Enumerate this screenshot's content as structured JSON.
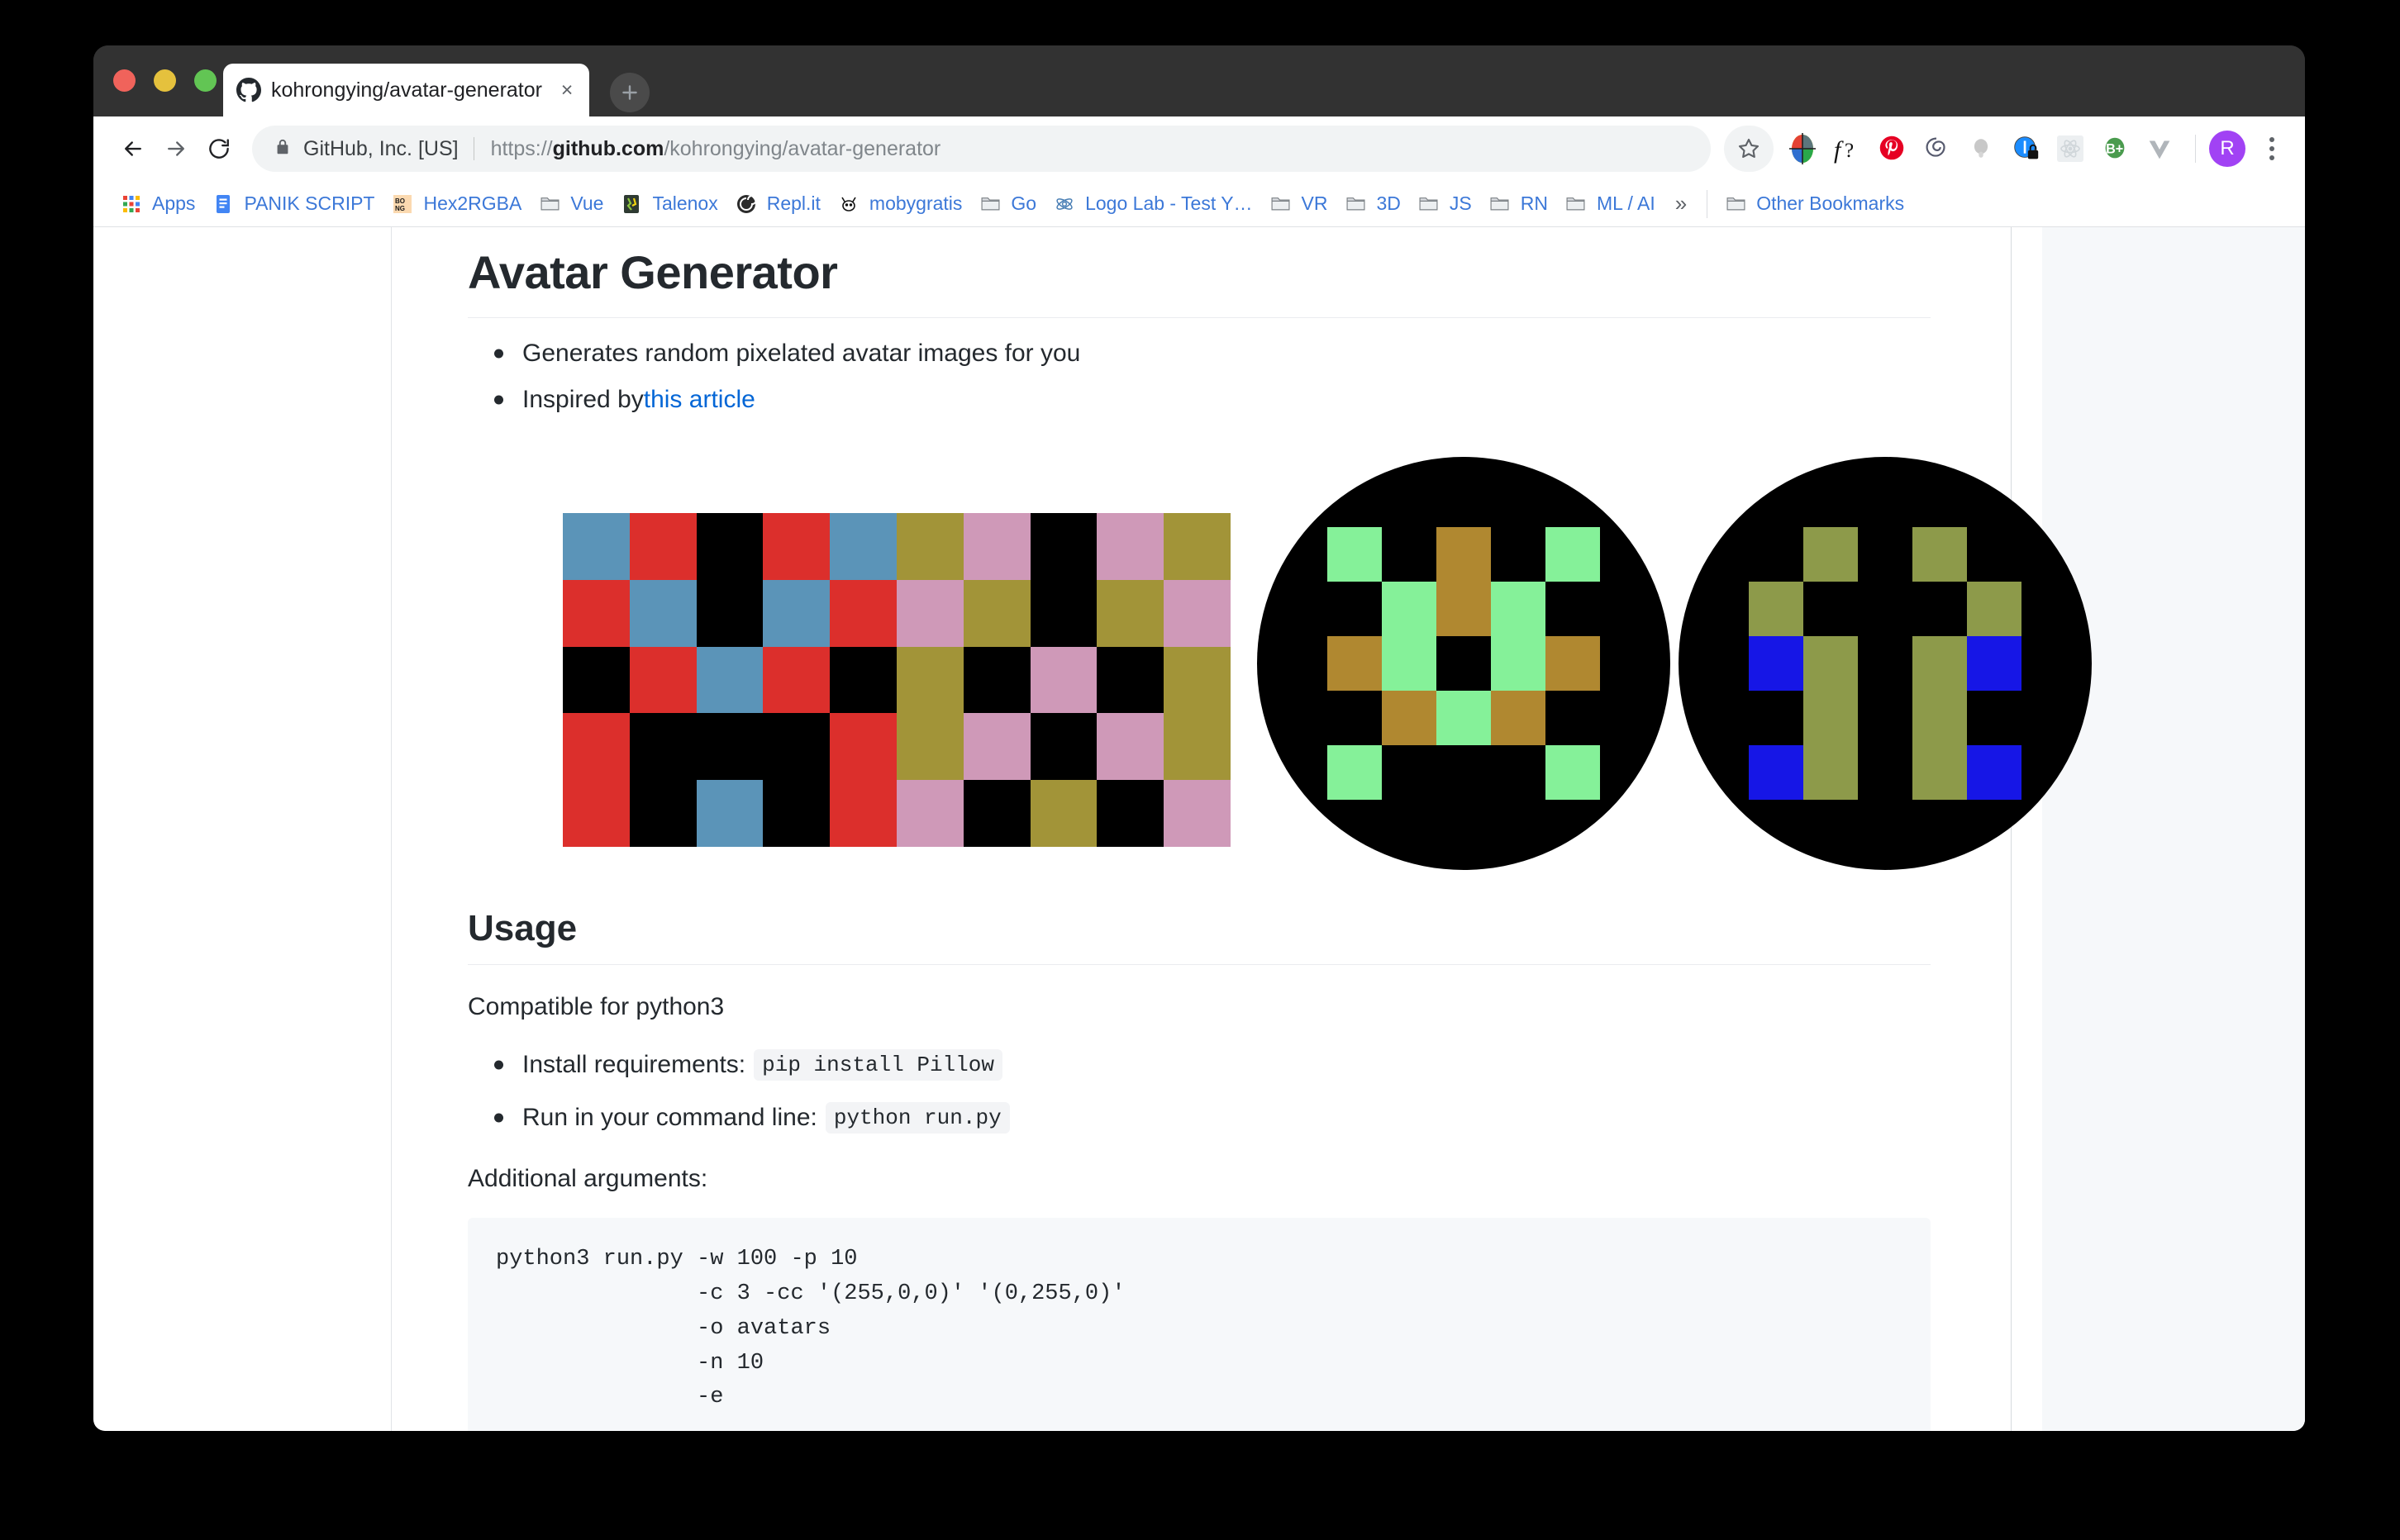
{
  "window": {
    "traffic_lights": [
      "close",
      "minimize",
      "maximize"
    ]
  },
  "tab": {
    "favicon": "github-icon",
    "title": "kohrongying/avatar-generator",
    "close_label": "×",
    "new_tab_label": "+"
  },
  "toolbar": {
    "back_label": "back-icon",
    "forward_label": "forward-icon",
    "reload_label": "reload-icon",
    "lock_label": "lock-icon",
    "site_identity": "GitHub, Inc. [US]",
    "url_scheme": "https://",
    "url_domain": "github.com",
    "url_path": "/kohrongying/avatar-generator",
    "star_label": "bookmark-star-icon",
    "profile_initial": "R",
    "menu_label": "chrome-menu-icon",
    "extensions": [
      {
        "name": "color-wheel-extension-icon",
        "color": "#4caf50"
      },
      {
        "name": "fonts-ninja-extension-icon",
        "color": "#111111"
      },
      {
        "name": "pinterest-extension-icon",
        "color": "#e60023"
      },
      {
        "name": "loom-extension-icon",
        "color": "#565a6e"
      },
      {
        "name": "grey-pin-extension-icon",
        "color": "#c8c8c8"
      },
      {
        "name": "onetab-lock-extension-icon",
        "color": "#1a8cff"
      },
      {
        "name": "react-devtools-extension-icon",
        "color": "#d9dde0"
      },
      {
        "name": "bitly-extension-icon",
        "color": "#4a9b4e"
      },
      {
        "name": "vue-devtools-extension-icon",
        "color": "#b0b5ba"
      }
    ]
  },
  "bookmarks": {
    "items": [
      {
        "label": "Apps",
        "icon": "apps-grid-icon"
      },
      {
        "label": "PANIK SCRIPT",
        "icon": "google-docs-icon"
      },
      {
        "label": "Hex2RGBA",
        "icon": "bong-icon"
      },
      {
        "label": "Vue",
        "icon": "folder-icon"
      },
      {
        "label": "Talenox",
        "icon": "talenox-icon"
      },
      {
        "label": "Repl.it",
        "icon": "replit-icon"
      },
      {
        "label": "mobygratis",
        "icon": "moby-icon"
      },
      {
        "label": "Go",
        "icon": "folder-icon"
      },
      {
        "label": "Logo Lab - Test Y…",
        "icon": "logolab-icon"
      },
      {
        "label": "VR",
        "icon": "folder-icon"
      },
      {
        "label": "3D",
        "icon": "folder-icon"
      },
      {
        "label": "JS",
        "icon": "folder-icon"
      },
      {
        "label": "RN",
        "icon": "folder-icon"
      },
      {
        "label": "ML / AI",
        "icon": "folder-icon"
      }
    ],
    "overflow_label": "»",
    "other_bookmarks": {
      "label": "Other Bookmarks",
      "icon": "folder-icon"
    }
  },
  "readme": {
    "title": "Avatar Generator",
    "features": [
      {
        "text": "Generates random pixelated avatar images for you"
      },
      {
        "text": "Inspired by ",
        "link_text": "this article"
      }
    ],
    "usage_heading": "Usage",
    "compatible_line": "Compatible for python3",
    "usage_items": [
      {
        "text": "Install requirements:",
        "code": "pip install Pillow"
      },
      {
        "text": "Run in your command line:",
        "code": "python run.py"
      }
    ],
    "additional_args_label": "Additional arguments:",
    "code_block": "python3 run.py -w 100 -p 10\n               -c 3 -cc '(255,0,0)' '(0,255,0)'\n               -o avatars\n               -n 10\n               -e"
  },
  "avatars": {
    "palette": {
      "black": "#000000",
      "blue_grey": "#5b94b8",
      "red": "#dc2f2c",
      "olive": "#a29438",
      "pink": "#cf99b8",
      "light_green": "#85f199",
      "brown": "#b08830",
      "dark_olive": "#8d9a4a",
      "blue": "#1616e6"
    },
    "items": [
      {
        "name": "avatar-square-red-blue",
        "shape": "square",
        "grid": [
          [
            "blue_grey",
            "red",
            "black",
            "red",
            "blue_grey"
          ],
          [
            "red",
            "blue_grey",
            "black",
            "blue_grey",
            "red"
          ],
          [
            "black",
            "red",
            "blue_grey",
            "red",
            "black"
          ],
          [
            "red",
            "black",
            "black",
            "black",
            "red"
          ],
          [
            "red",
            "black",
            "blue_grey",
            "black",
            "red"
          ]
        ]
      },
      {
        "name": "avatar-square-olive-pink",
        "shape": "square",
        "grid": [
          [
            "olive",
            "pink",
            "black",
            "pink",
            "olive"
          ],
          [
            "pink",
            "olive",
            "black",
            "olive",
            "pink"
          ],
          [
            "olive",
            "black",
            "pink",
            "black",
            "olive"
          ],
          [
            "olive",
            "pink",
            "black",
            "pink",
            "olive"
          ],
          [
            "pink",
            "black",
            "olive",
            "black",
            "pink"
          ]
        ]
      },
      {
        "name": "avatar-circle-green-brown",
        "shape": "round",
        "grid": [
          [
            "light_green",
            "black",
            "brown",
            "black",
            "light_green"
          ],
          [
            "black",
            "light_green",
            "brown",
            "light_green",
            "black"
          ],
          [
            "brown",
            "light_green",
            "black",
            "light_green",
            "brown"
          ],
          [
            "black",
            "brown",
            "light_green",
            "brown",
            "black"
          ],
          [
            "light_green",
            "black",
            "black",
            "black",
            "light_green"
          ]
        ]
      },
      {
        "name": "avatar-circle-olive-blue",
        "shape": "round",
        "grid": [
          [
            "black",
            "dark_olive",
            "black",
            "dark_olive",
            "black"
          ],
          [
            "dark_olive",
            "black",
            "black",
            "black",
            "dark_olive"
          ],
          [
            "blue",
            "dark_olive",
            "black",
            "dark_olive",
            "blue"
          ],
          [
            "black",
            "dark_olive",
            "black",
            "dark_olive",
            "black"
          ],
          [
            "blue",
            "dark_olive",
            "black",
            "dark_olive",
            "blue"
          ]
        ]
      }
    ]
  }
}
